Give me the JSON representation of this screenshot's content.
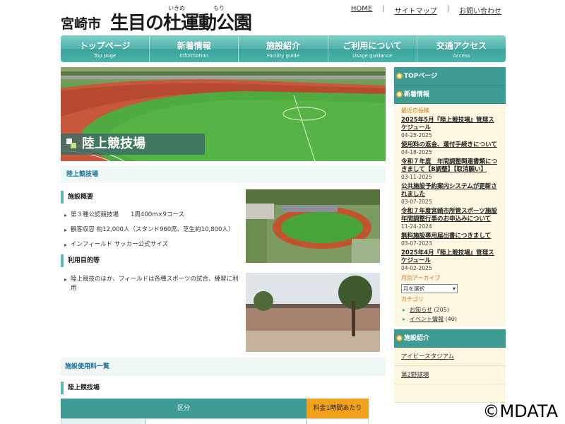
{
  "header": {
    "city": "宮崎市",
    "park_name": "生目の杜運動公園",
    "ruby_ikime": "いきめ",
    "ruby_mori": "もり",
    "links": [
      "HOME",
      "サイトマップ",
      "お問い合わせ"
    ]
  },
  "nav": [
    {
      "jp": "トップページ",
      "en": "Top page"
    },
    {
      "jp": "新着情報",
      "en": "Information"
    },
    {
      "jp": "施設紹介",
      "en": "Facility guide"
    },
    {
      "jp": "ご利用について",
      "en": "Usage guidance"
    },
    {
      "jp": "交通アクセス",
      "en": "Access"
    }
  ],
  "hero": {
    "label": "陸上競技場"
  },
  "main": {
    "breadcrumb": "陸上競技場",
    "overview_heading": "施設概要",
    "overview_items": [
      "第３種公認競技場　　1周400m×9コース",
      "観客収容 約12,000人（スタンド960席、芝生約10,800人）",
      "インフィールド サッカー公式サイズ"
    ],
    "purpose_heading": "利用目的等",
    "purpose_items": [
      "陸上競技のほか、フィールドは各種スポーツの試合、練習に利用"
    ],
    "usage_list_title": "施設使用料一覧",
    "usage_heading": "陸上競技場",
    "table_headers": [
      "区分",
      "料金1時間あたり"
    ]
  },
  "sidebar": {
    "top_label": "TOPページ",
    "news_label": "新着情報",
    "recent_label": "最近の投稿",
    "posts": [
      {
        "title": "2025年5月『陸上競技場』管理スケジュール",
        "date": "04-25-2025"
      },
      {
        "title": "使用料の返金、還付手続きについて",
        "date": "04-18-2025"
      },
      {
        "title": "令和７年度　年間調整関連書類につきまして【B調整】【取消願い】",
        "date": "03-11-2025"
      },
      {
        "title": "公共施設予約案内システムが更新されました",
        "date": "03-07-2025"
      },
      {
        "title": "令和７年度宮崎市所管スポーツ施設年間調整行事のお申込みについて",
        "date": "11-24-2024"
      },
      {
        "title": "無料施設専用届出書につきまして",
        "date": "03-07-2023"
      },
      {
        "title": "2025年4月『陸上競技場』管理スケジュール",
        "date": "04-02-2025"
      }
    ],
    "archive_label": "月別アーカイブ",
    "archive_select": "月を選択",
    "category_label": "カテゴリ",
    "categories": [
      {
        "name": "お知らせ",
        "count": "(205)"
      },
      {
        "name": "イベント情報",
        "count": "(40)"
      }
    ],
    "facility_label": "施設紹介",
    "facilities": [
      "アイビースタジアム",
      "第2野球場",
      ""
    ]
  },
  "watermark": "©MDATA"
}
